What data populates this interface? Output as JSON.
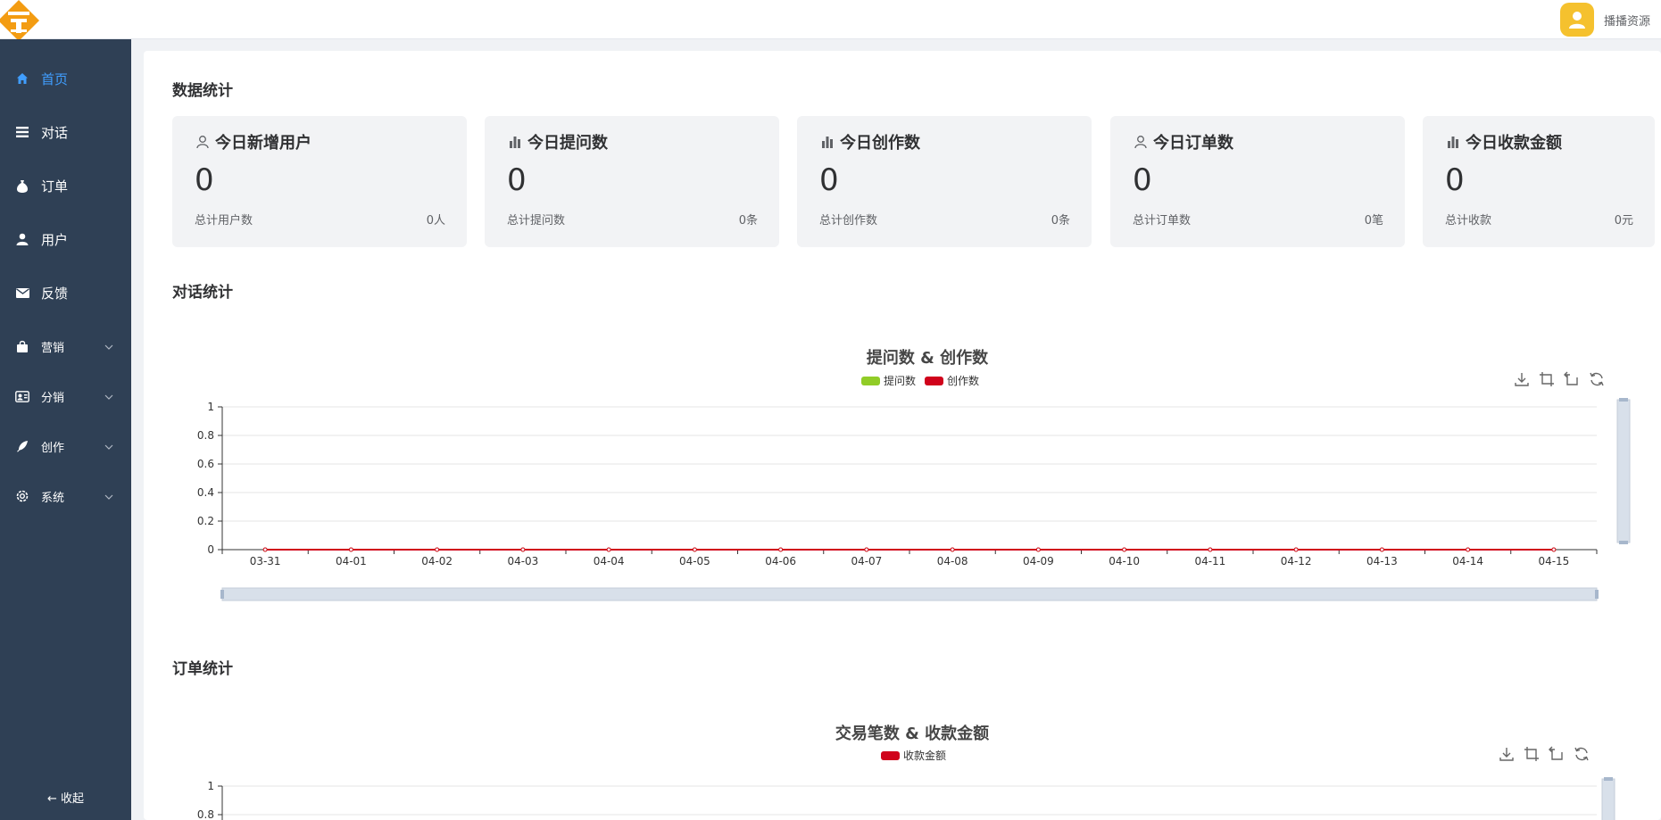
{
  "header": {
    "user_name": "播播资源"
  },
  "sidebar": {
    "items": [
      {
        "label": "首页"
      },
      {
        "label": "对话"
      },
      {
        "label": "订单"
      },
      {
        "label": "用户"
      },
      {
        "label": "反馈"
      },
      {
        "label": "营销"
      },
      {
        "label": "分销"
      },
      {
        "label": "创作"
      },
      {
        "label": "系统"
      }
    ],
    "collapse_label": "收起"
  },
  "sections": {
    "stats": "数据统计",
    "chat": "对话统计",
    "orders": "订单统计"
  },
  "cards": [
    {
      "title": "今日新增用户",
      "value": "0",
      "foot_label": "总计用户数",
      "foot_value": "0人"
    },
    {
      "title": "今日提问数",
      "value": "0",
      "foot_label": "总计提问数",
      "foot_value": "0条"
    },
    {
      "title": "今日创作数",
      "value": "0",
      "foot_label": "总计创作数",
      "foot_value": "0条"
    },
    {
      "title": "今日订单数",
      "value": "0",
      "foot_label": "总计订单数",
      "foot_value": "0笔"
    },
    {
      "title": "今日收款金额",
      "value": "0",
      "foot_label": "总计收款",
      "foot_value": "0元"
    }
  ],
  "chart_data": [
    {
      "type": "line",
      "title": "提问数 & 创作数",
      "categories": [
        "03-31",
        "04-01",
        "04-02",
        "04-03",
        "04-04",
        "04-05",
        "04-06",
        "04-07",
        "04-08",
        "04-09",
        "04-10",
        "04-11",
        "04-12",
        "04-13",
        "04-14",
        "04-15"
      ],
      "series": [
        {
          "name": "提问数",
          "color": "#91cc27",
          "values": [
            0,
            0,
            0,
            0,
            0,
            0,
            0,
            0,
            0,
            0,
            0,
            0,
            0,
            0,
            0,
            0
          ]
        },
        {
          "name": "创作数",
          "color": "#d0021b",
          "values": [
            0,
            0,
            0,
            0,
            0,
            0,
            0,
            0,
            0,
            0,
            0,
            0,
            0,
            0,
            0,
            0
          ]
        }
      ],
      "y_ticks": [
        "0",
        "0.2",
        "0.4",
        "0.6",
        "0.8",
        "1"
      ],
      "ylim": [
        0,
        1
      ],
      "grid": true,
      "legend": "top-center"
    },
    {
      "type": "line",
      "title": "交易笔数 & 收款金额",
      "series": [
        {
          "name": "收款金额",
          "color": "#d0021b",
          "values": []
        }
      ],
      "y_ticks_visible": [
        "0.8",
        "1"
      ],
      "ylim": [
        0,
        1
      ],
      "grid": true,
      "legend": "top-center"
    }
  ],
  "colors": {
    "sidebar_bg": "#2f4055",
    "active": "#409eff",
    "accent_logo": "#f39c12"
  }
}
